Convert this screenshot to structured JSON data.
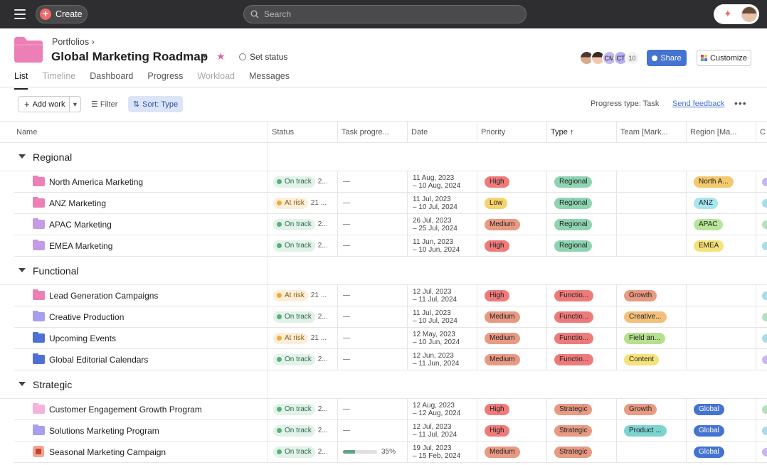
{
  "topbar": {
    "create_label": "Create",
    "search_placeholder": "Search"
  },
  "header": {
    "breadcrumb": "Portfolios",
    "title": "Global Marketing Roadmap",
    "set_status": "Set status",
    "member_initials": [
      "",
      "",
      "CM",
      "CT"
    ],
    "member_count": "10",
    "share_label": "Share",
    "customize_label": "Customize"
  },
  "tabs": [
    {
      "label": "List",
      "state": "active"
    },
    {
      "label": "Timeline",
      "state": "muted"
    },
    {
      "label": "Dashboard",
      "state": "normal"
    },
    {
      "label": "Progress",
      "state": "normal"
    },
    {
      "label": "Workload",
      "state": "muted"
    },
    {
      "label": "Messages",
      "state": "normal"
    }
  ],
  "toolbar": {
    "add_work": "Add work",
    "filter": "Filter",
    "sort": "Sort: Type",
    "progress_type": "Progress type: Task",
    "send_feedback": "Send feedback"
  },
  "columns": [
    "Name",
    "Status",
    "Task progre...",
    "Date",
    "Priority",
    "Type",
    "Team [Mark...",
    "Region [Ma..."
  ],
  "sections": [
    {
      "name": "Regional",
      "rows": [
        {
          "name": "North America Marketing",
          "folder": "#ec7fb6",
          "status": "On track",
          "status_extra": "2...",
          "progress": "—",
          "date1": "11 Aug, 2023",
          "date2": "– 10 Aug, 2024",
          "priority": "High",
          "type": "Regional",
          "team": "",
          "region": "North A..."
        },
        {
          "name": "ANZ Marketing",
          "folder": "#ec7fb6",
          "status": "At risk",
          "status_extra": "21 ...",
          "progress": "—",
          "date1": "11 Jul, 2023",
          "date2": "– 10 Jul, 2024",
          "priority": "Low",
          "type": "Regional",
          "team": "",
          "region": "ANZ"
        },
        {
          "name": "APAC Marketing",
          "folder": "#c39be6",
          "status": "On track",
          "status_extra": "2...",
          "progress": "—",
          "date1": "26 Jul, 2023",
          "date2": "– 25 Jul, 2024",
          "priority": "Medium",
          "type": "Regional",
          "team": "",
          "region": "APAC"
        },
        {
          "name": "EMEA Marketing",
          "folder": "#c39be6",
          "status": "On track",
          "status_extra": "2...",
          "progress": "—",
          "date1": "11 Jun, 2023",
          "date2": "– 10 Jun, 2024",
          "priority": "High",
          "type": "Regional",
          "team": "",
          "region": "EMEA"
        }
      ]
    },
    {
      "name": "Functional",
      "rows": [
        {
          "name": "Lead Generation Campaigns",
          "folder": "#ec7fb6",
          "status": "At risk",
          "status_extra": "21 ...",
          "progress": "—",
          "date1": "12 Jul, 2023",
          "date2": "– 11 Jul, 2024",
          "priority": "High",
          "type": "Functio...",
          "team": "Growth",
          "region": ""
        },
        {
          "name": "Creative Production",
          "folder": "#a89ef0",
          "status": "On track",
          "status_extra": "2...",
          "progress": "—",
          "date1": "11 Jul, 2023",
          "date2": "– 10 Jul, 2024",
          "priority": "Medium",
          "type": "Functio...",
          "team": "Creative...",
          "region": ""
        },
        {
          "name": "Upcoming Events",
          "folder": "#4f6fd6",
          "status": "At risk",
          "status_extra": "21 ...",
          "progress": "—",
          "date1": "12 May, 2023",
          "date2": "– 10 Jun, 2024",
          "priority": "Medium",
          "type": "Functio...",
          "team": "Field an...",
          "region": ""
        },
        {
          "name": "Global Editorial Calendars",
          "folder": "#4f6fd6",
          "status": "On track",
          "status_extra": "2...",
          "progress": "—",
          "date1": "12 Jun, 2023",
          "date2": "– 11 Jun, 2024",
          "priority": "Medium",
          "type": "Functio...",
          "team": "Content",
          "region": ""
        }
      ]
    },
    {
      "name": "Strategic",
      "rows": [
        {
          "name": "Customer Engagement Growth Program",
          "folder": "#f4b3dc",
          "status": "On track",
          "status_extra": "2...",
          "progress": "—",
          "date1": "12 Aug, 2023",
          "date2": "– 12 Aug, 2024",
          "priority": "High",
          "type": "Strategic",
          "team": "Growth",
          "region": "Global"
        },
        {
          "name": "Solutions Marketing Program",
          "folder": "#a89ef0",
          "status": "On track",
          "status_extra": "2...",
          "progress": "—",
          "date1": "12 Jul, 2023",
          "date2": "– 11 Jul, 2024",
          "priority": "High",
          "type": "Strategic",
          "team": "Product ...",
          "region": "Global"
        },
        {
          "name": "Seasonal Marketing Campaign",
          "folder": "campaign",
          "status": "On track",
          "status_extra": "2...",
          "progress": "35%",
          "progress_fraction": 0.35,
          "date1": "19 Jul, 2023",
          "date2": "– 15 Feb, 2024",
          "priority": "Medium",
          "type": "Strategic",
          "team": "",
          "region": "Global"
        }
      ]
    }
  ],
  "colors": {
    "accent": "#4573d2",
    "create": "#f06a6a",
    "star": "#e362a8",
    "big_folder": "#ec7fb6"
  }
}
